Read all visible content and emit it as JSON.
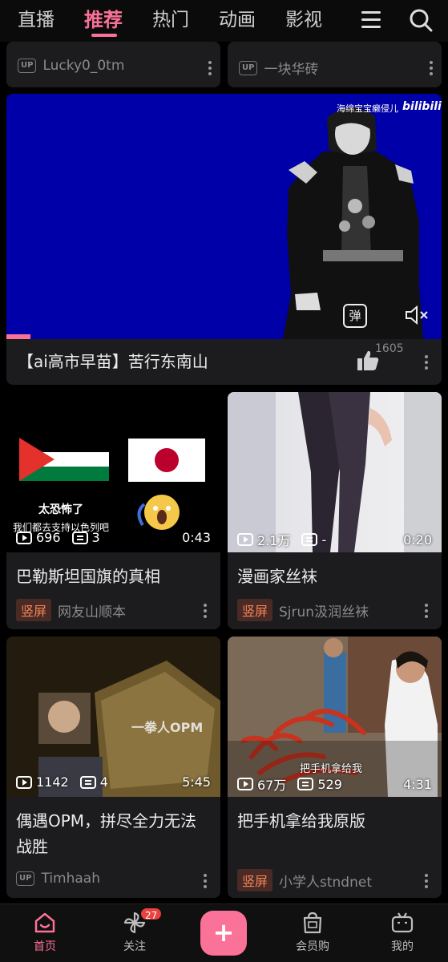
{
  "topnav": {
    "tabs": [
      {
        "label": "直播"
      },
      {
        "label": "推荐"
      },
      {
        "label": "热门"
      },
      {
        "label": "动画"
      },
      {
        "label": "影视"
      }
    ],
    "active_tab": "推荐"
  },
  "partial_cards": [
    {
      "uploader": "Lucky0_0tm",
      "badge": "UP"
    },
    {
      "uploader": "一块华砖",
      "badge": "UP"
    }
  ],
  "featured": {
    "watermark": "海绵宝宝癞侵儿",
    "brand": "bilibili",
    "danmaku_button": "弹",
    "title": "【ai高市早苗】苦行东南山",
    "likes": "1605",
    "progress": 0.05
  },
  "cards": [
    {
      "title": "巴勒斯坦国旗的真相",
      "views": "696",
      "danmaku": "3",
      "duration": "0:43",
      "tag": "竖屏",
      "uploader": "网友山顺本",
      "overlay1": "太恐怖了",
      "overlay2": "我们都去支持以色列吧"
    },
    {
      "title": "漫画家丝袜",
      "views": "2.1万",
      "danmaku": "-",
      "duration": "0:20",
      "tag": "竖屏",
      "uploader": "Sjrun汲润丝袜"
    },
    {
      "title": "偶遇OPM，拼尽全力无法战胜",
      "views": "1142",
      "danmaku": "4",
      "duration": "5:45",
      "badge": "UP",
      "uploader": "Timhaah",
      "overlay1": "一拳人OPM"
    },
    {
      "title": "把手机拿给我原版",
      "views": "67万",
      "danmaku": "529",
      "duration": "4:31",
      "tag": "竖屏",
      "uploader": "小学人stndnet",
      "overlay1": "把手机拿给我"
    }
  ],
  "bottombar": {
    "home": "首页",
    "follow": "关注",
    "follow_count": "27",
    "create": "+",
    "shop": "会员购",
    "mine": "我的"
  },
  "colors": {
    "accent": "#fb7299",
    "video_bg": "#0000a8",
    "tag_bg": "#4a2a24",
    "tag_fg": "#f0845a"
  }
}
